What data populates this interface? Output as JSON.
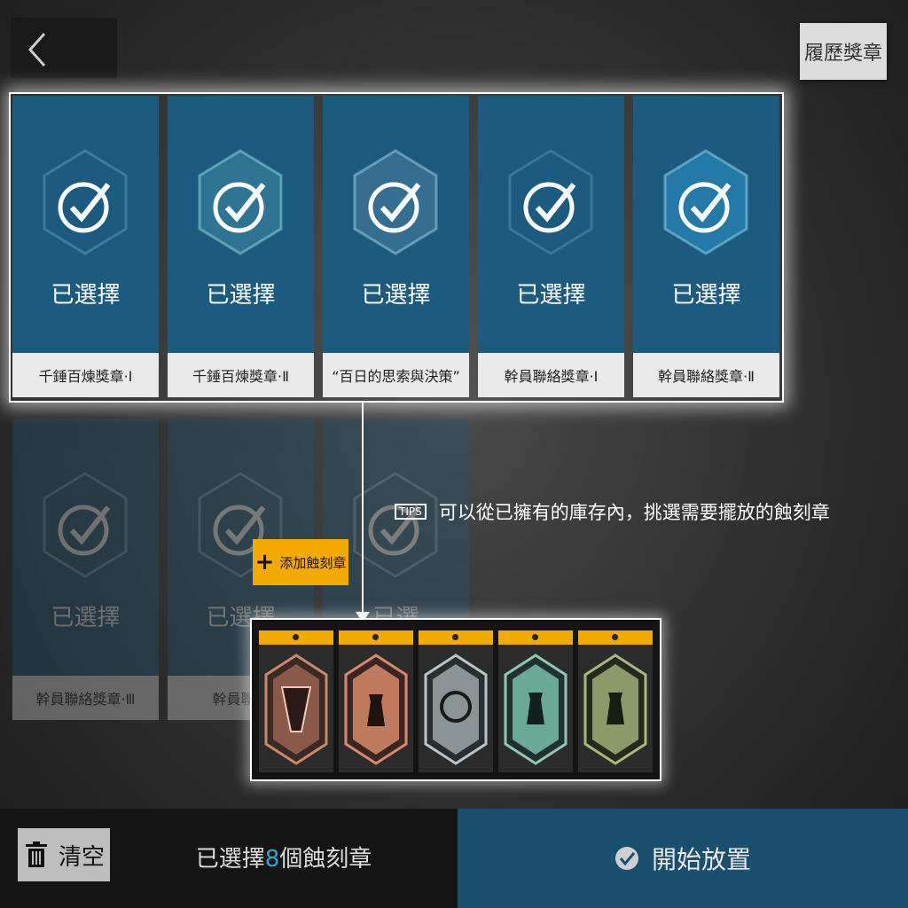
{
  "header": {
    "history_label": "履歷獎章"
  },
  "highlighted_row": [
    {
      "name": "千錘百煉獎章·Ⅰ",
      "status": "已選擇"
    },
    {
      "name": "千錘百煉獎章·Ⅱ",
      "status": "已選擇"
    },
    {
      "name": "“百日的思索與決策”",
      "status": "已選擇"
    },
    {
      "name": "幹員聯絡獎章·Ⅰ",
      "status": "已選擇"
    },
    {
      "name": "幹員聯絡獎章·Ⅱ",
      "status": "已選擇"
    }
  ],
  "dim_row": [
    {
      "name": "幹員聯絡獎章·Ⅲ",
      "status": "已選擇"
    },
    {
      "name": "幹員聯絡",
      "status": "已選擇"
    },
    {
      "name": "",
      "status": "已選"
    }
  ],
  "tips": {
    "badge": "TIPS",
    "text": "可以從已擁有的庫存內，挑選需要擺放的蝕刻章"
  },
  "add_button": {
    "label": "添加蝕刻章"
  },
  "inventory": {
    "slots": [
      {
        "icon": "badge-bronze-icon",
        "color": "#c98a6a"
      },
      {
        "icon": "badge-rook-120-icon",
        "color": "#d68c6c"
      },
      {
        "icon": "badge-one-hundred-days-icon",
        "color": "#b9c6c9"
      },
      {
        "icon": "badge-rook-100-icon",
        "color": "#8ec8b4"
      },
      {
        "icon": "badge-rook-50-icon",
        "color": "#a6b87a"
      }
    ]
  },
  "footer": {
    "clear_label": "清空",
    "selected_prefix": "已選擇",
    "selected_count": "8",
    "selected_suffix": "個蝕刻章",
    "start_label": "開始放置"
  },
  "colors": {
    "accent": "#f2a900",
    "card_blue": "#1d5a80",
    "count_blue": "#2aa6d8"
  }
}
